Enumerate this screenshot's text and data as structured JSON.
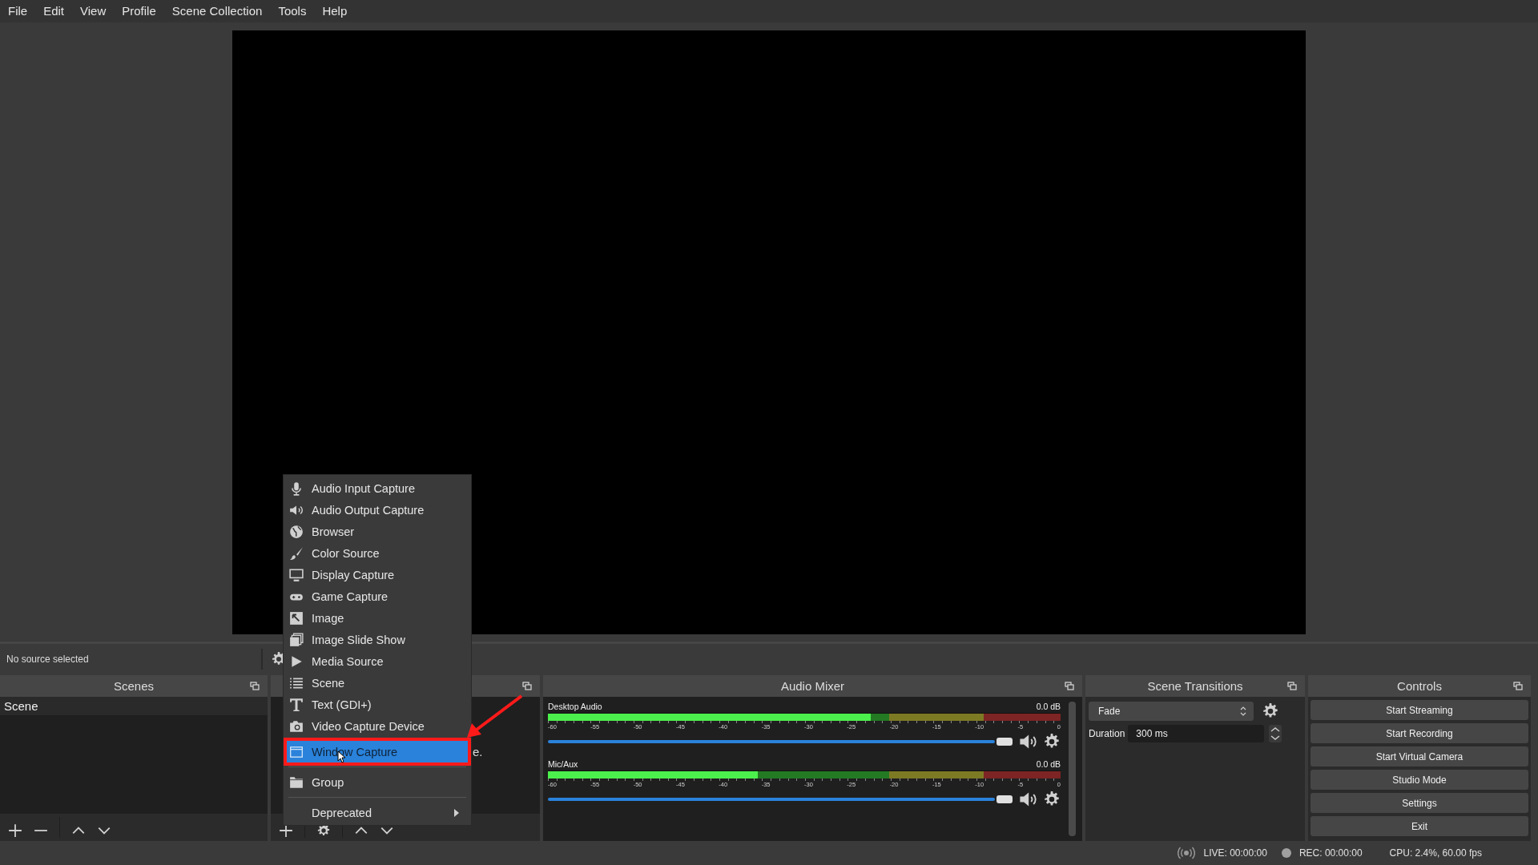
{
  "menu_bar": [
    {
      "label": "File"
    },
    {
      "label": "Edit"
    },
    {
      "label": "View"
    },
    {
      "label": "Profile"
    },
    {
      "label": "Scene Collection"
    },
    {
      "label": "Tools"
    },
    {
      "label": "Help"
    }
  ],
  "source_toolbar": {
    "status": "No source selected"
  },
  "scenes": {
    "title": "Scenes",
    "items": [
      {
        "label": "Scene",
        "selected": false
      }
    ]
  },
  "sources": {
    "hint": "e."
  },
  "audio_mixer": {
    "title": "Audio Mixer",
    "channels": [
      {
        "name": "Desktop Audio",
        "reading": "0.0 dB",
        "muted": false,
        "meter": {
          "level": 0.63
        },
        "volume": {
          "level": 1
        },
        "scale": [
          "-60",
          "-55",
          "-50",
          "-45",
          "-40",
          "-35",
          "-30",
          "-25",
          "-20",
          "-15",
          "-10",
          "-5",
          "0"
        ]
      },
      {
        "name": "Mic/Aux",
        "reading": "0.0 dB",
        "muted": false,
        "meter": {
          "level": 0.41
        },
        "volume": {
          "level": 1
        },
        "scale": [
          "-60",
          "-55",
          "-50",
          "-45",
          "-40",
          "-35",
          "-30",
          "-25",
          "-20",
          "-15",
          "-10",
          "-5",
          "0"
        ]
      }
    ]
  },
  "scene_transitions": {
    "title": "Scene Transitions",
    "transition": "Fade",
    "duration_label": "Duration",
    "duration": "300 ms"
  },
  "controls": {
    "title": "Controls",
    "buttons": [
      {
        "label": "Start Streaming"
      },
      {
        "label": "Start Recording"
      },
      {
        "label": "Start Virtual Camera"
      },
      {
        "label": "Studio Mode"
      },
      {
        "label": "Settings"
      },
      {
        "label": "Exit"
      }
    ]
  },
  "status_bar": {
    "live": "LIVE: 00:00:00",
    "rec": "REC: 00:00:00",
    "stats": "CPU: 2.4%, 60.00 fps"
  },
  "context_menu": {
    "sections": [
      [
        {
          "label": "Audio Input Capture",
          "kind": "microphone",
          "selected": false,
          "annotated": false,
          "submenu": false
        },
        {
          "label": "Audio Output Capture",
          "kind": "speaker",
          "selected": false,
          "annotated": false,
          "submenu": false
        },
        {
          "label": "Browser",
          "kind": "globe",
          "selected": false,
          "annotated": false,
          "submenu": false
        },
        {
          "label": "Color Source",
          "kind": "brush",
          "selected": false,
          "annotated": false,
          "submenu": false
        },
        {
          "label": "Display Capture",
          "kind": "monitor",
          "selected": false,
          "annotated": false,
          "submenu": false
        },
        {
          "label": "Game Capture",
          "kind": "gamepad",
          "selected": false,
          "annotated": false,
          "submenu": false
        },
        {
          "label": "Image",
          "kind": "image",
          "selected": false,
          "annotated": false,
          "submenu": false
        },
        {
          "label": "Image Slide Show",
          "kind": "slides",
          "selected": false,
          "annotated": false,
          "submenu": false
        },
        {
          "label": "Media Source",
          "kind": "play",
          "selected": false,
          "annotated": false,
          "submenu": false
        },
        {
          "label": "Scene",
          "kind": "list",
          "selected": false,
          "annotated": false,
          "submenu": false
        },
        {
          "label": "Text (GDI+)",
          "kind": "text",
          "selected": false,
          "annotated": false,
          "submenu": false
        },
        {
          "label": "Video Capture Device",
          "kind": "camera",
          "selected": false,
          "annotated": false,
          "submenu": false
        },
        {
          "label": "Window Capture",
          "kind": "window",
          "selected": true,
          "annotated": true,
          "submenu": false
        }
      ],
      [
        {
          "label": "Group",
          "kind": "folder",
          "selected": false,
          "annotated": false,
          "submenu": false
        }
      ],
      [
        {
          "label": "Deprecated",
          "kind": "none",
          "selected": false,
          "annotated": false,
          "submenu": true
        }
      ]
    ]
  }
}
